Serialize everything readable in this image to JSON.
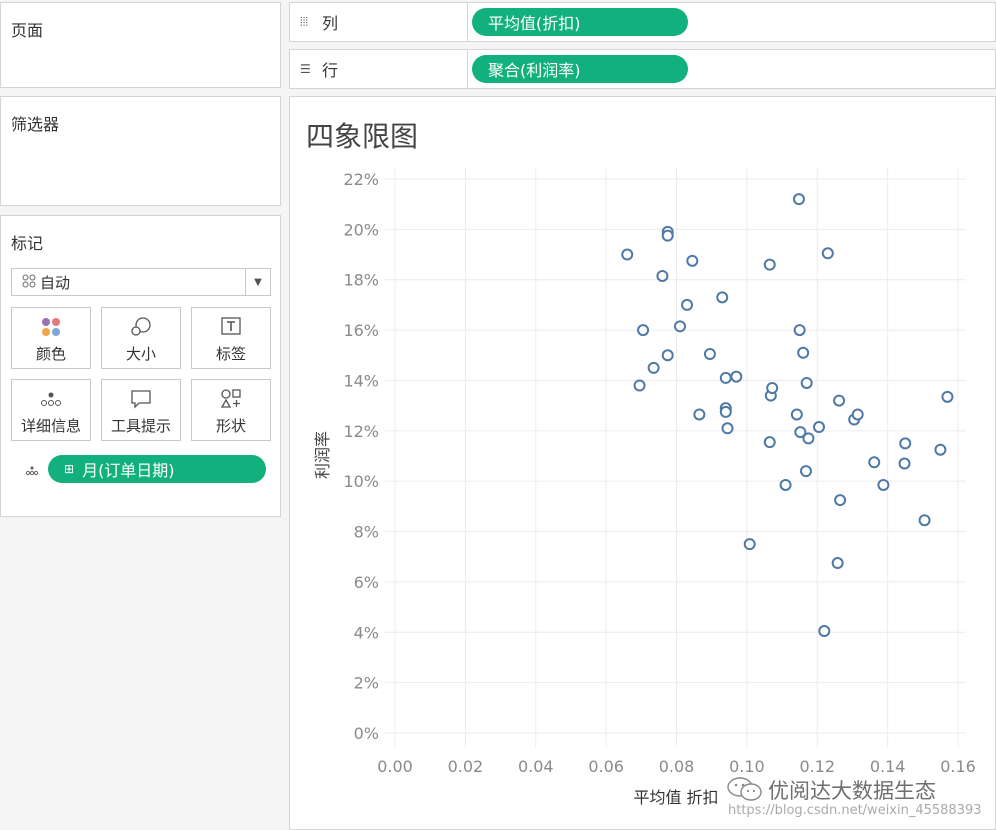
{
  "left_panel": {
    "pages_title": "页面",
    "filters_title": "筛选器",
    "marks": {
      "title": "标记",
      "type_select": "自动",
      "buttons": [
        "颜色",
        "大小",
        "标签",
        "详细信息",
        "工具提示",
        "形状"
      ],
      "field_pill": "月(订单日期)"
    }
  },
  "shelves": {
    "columns_label": "列",
    "columns_pill": "平均值(折扣)",
    "rows_label": "行",
    "rows_pill": "聚合(利润率)"
  },
  "worksheet": {
    "title": "四象限图",
    "watermark_brand": "优阅达大数据生态",
    "watermark_url": "https://blog.csdn.net/weixin_45588393"
  },
  "chart_data": {
    "type": "scatter",
    "title": "四象限图",
    "xlabel": "平均值 折扣",
    "ylabel": "利润率",
    "xlim": [
      0.0,
      0.16
    ],
    "ylim": [
      0,
      22
    ],
    "x_ticks": [
      "0.00",
      "0.02",
      "0.04",
      "0.06",
      "0.08",
      "0.10",
      "0.12",
      "0.14",
      "0.16"
    ],
    "y_ticks": [
      "0%",
      "2%",
      "4%",
      "6%",
      "8%",
      "10%",
      "12%",
      "14%",
      "16%",
      "18%",
      "20%",
      "22%"
    ],
    "grid": true,
    "marker_color": "#4e79a7",
    "points": [
      {
        "x": 0.066,
        "y": 19.0
      },
      {
        "x": 0.0775,
        "y": 19.9
      },
      {
        "x": 0.0775,
        "y": 19.75
      },
      {
        "x": 0.076,
        "y": 18.15
      },
      {
        "x": 0.0845,
        "y": 18.75
      },
      {
        "x": 0.0695,
        "y": 13.8
      },
      {
        "x": 0.0705,
        "y": 16.0
      },
      {
        "x": 0.0735,
        "y": 14.5
      },
      {
        "x": 0.0775,
        "y": 15.0
      },
      {
        "x": 0.081,
        "y": 16.15
      },
      {
        "x": 0.083,
        "y": 17.0
      },
      {
        "x": 0.0865,
        "y": 12.65
      },
      {
        "x": 0.0895,
        "y": 15.05
      },
      {
        "x": 0.093,
        "y": 17.3
      },
      {
        "x": 0.094,
        "y": 14.1
      },
      {
        "x": 0.094,
        "y": 12.9
      },
      {
        "x": 0.094,
        "y": 12.75
      },
      {
        "x": 0.0945,
        "y": 12.1
      },
      {
        "x": 0.097,
        "y": 14.15
      },
      {
        "x": 0.1008,
        "y": 7.5
      },
      {
        "x": 0.1065,
        "y": 18.6
      },
      {
        "x": 0.1065,
        "y": 11.55
      },
      {
        "x": 0.1068,
        "y": 13.4
      },
      {
        "x": 0.1072,
        "y": 13.7
      },
      {
        "x": 0.111,
        "y": 9.85
      },
      {
        "x": 0.1142,
        "y": 12.65
      },
      {
        "x": 0.1148,
        "y": 21.2
      },
      {
        "x": 0.115,
        "y": 16.0
      },
      {
        "x": 0.1152,
        "y": 11.95
      },
      {
        "x": 0.116,
        "y": 15.1
      },
      {
        "x": 0.1168,
        "y": 10.4
      },
      {
        "x": 0.117,
        "y": 13.9
      },
      {
        "x": 0.1175,
        "y": 11.7
      },
      {
        "x": 0.1205,
        "y": 12.15
      },
      {
        "x": 0.122,
        "y": 4.05
      },
      {
        "x": 0.123,
        "y": 19.05
      },
      {
        "x": 0.1258,
        "y": 6.75
      },
      {
        "x": 0.1262,
        "y": 13.2
      },
      {
        "x": 0.1265,
        "y": 9.25
      },
      {
        "x": 0.1305,
        "y": 12.45
      },
      {
        "x": 0.1315,
        "y": 12.65
      },
      {
        "x": 0.1362,
        "y": 10.75
      },
      {
        "x": 0.1388,
        "y": 9.85
      },
      {
        "x": 0.1448,
        "y": 10.7
      },
      {
        "x": 0.145,
        "y": 11.5
      },
      {
        "x": 0.1505,
        "y": 8.45
      },
      {
        "x": 0.155,
        "y": 11.25
      },
      {
        "x": 0.157,
        "y": 13.35
      }
    ]
  }
}
